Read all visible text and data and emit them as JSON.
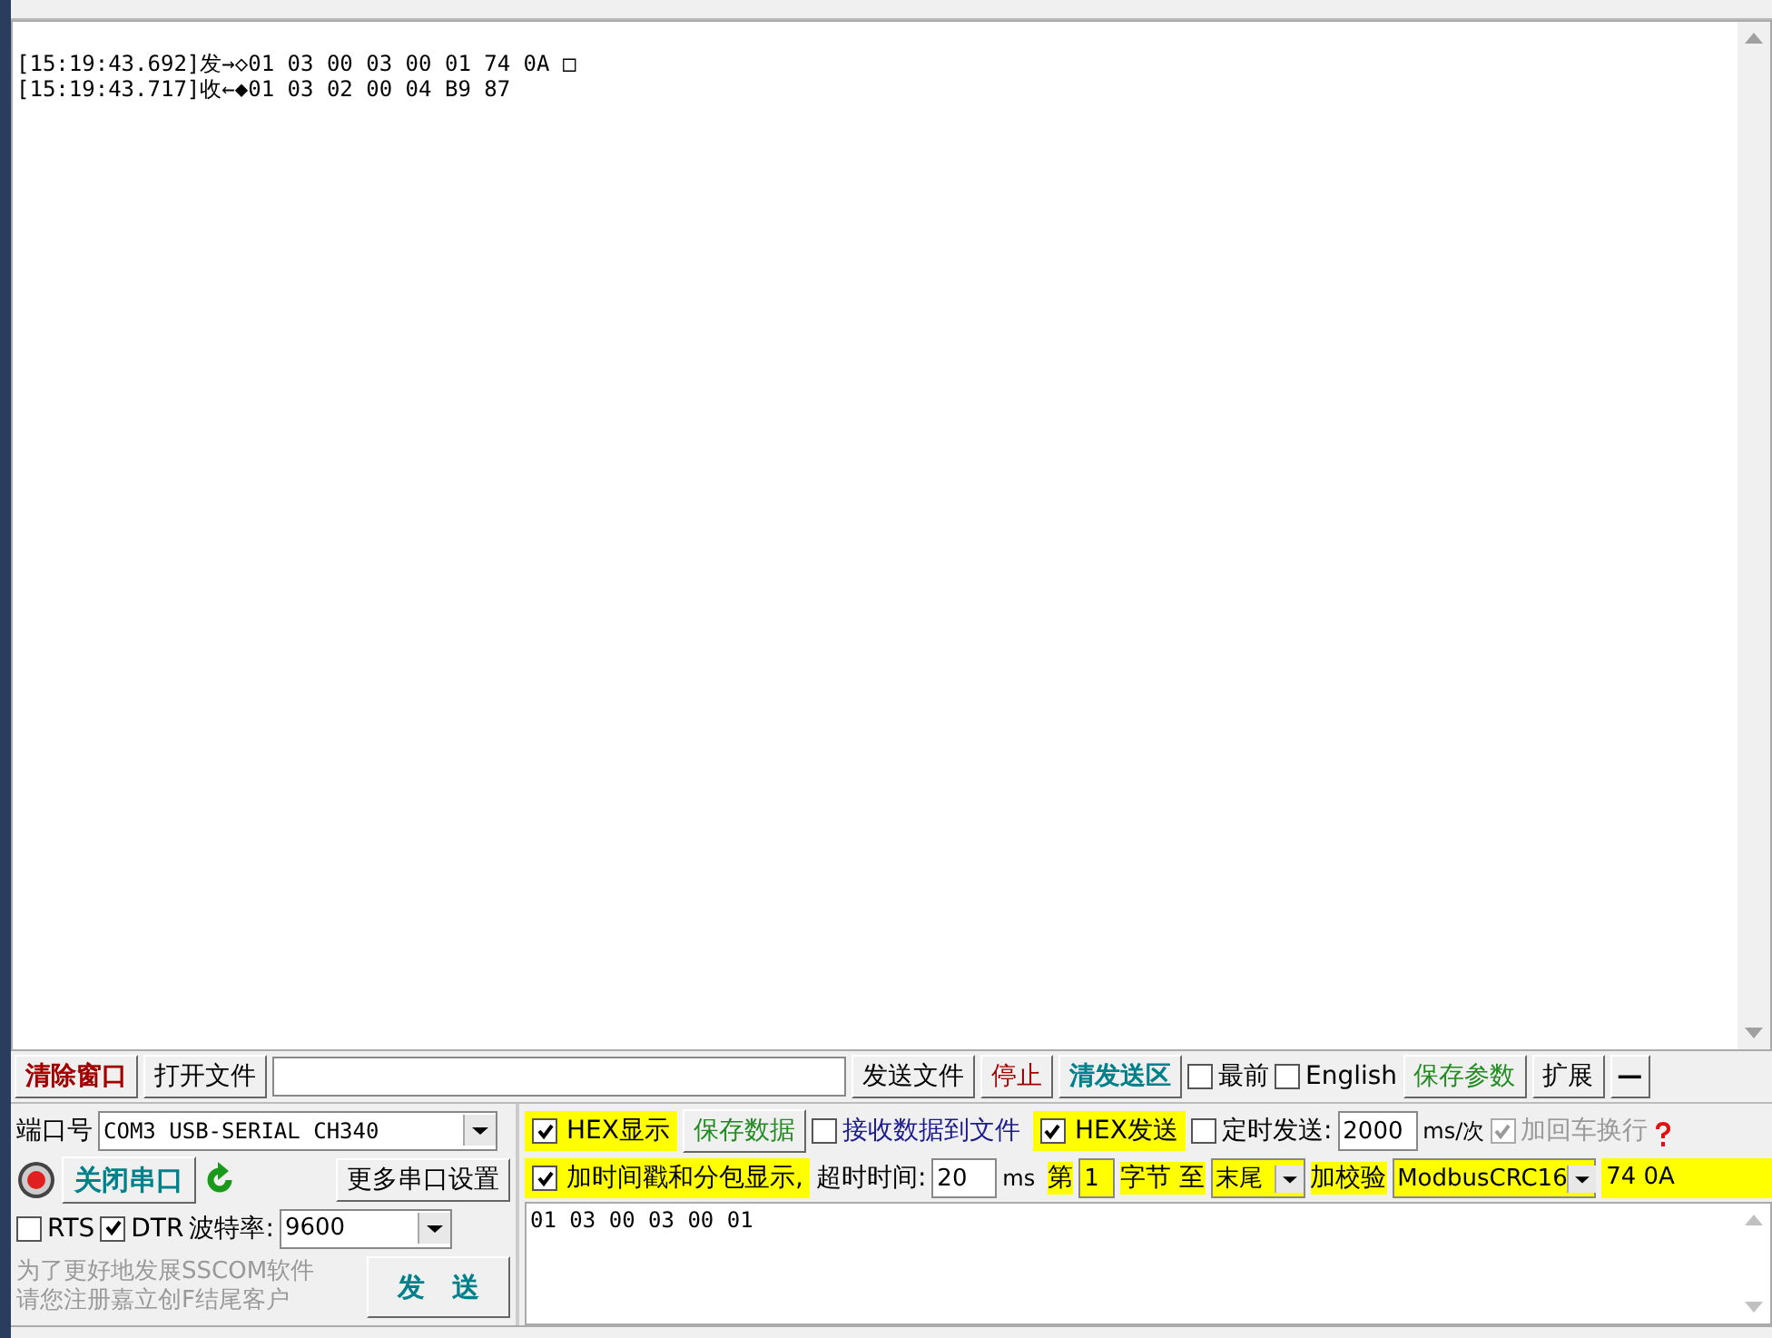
{
  "receive": {
    "lines": [
      "[15:19:43.692]发→◇01 03 00 03 00 01 74 0A □",
      "[15:19:43.717]收←◆01 03 02 00 04 B9 87"
    ]
  },
  "toolbar": {
    "clear_button": "清除窗口",
    "open_file_button": "打开文件",
    "send_file_button": "发送文件",
    "stop_button": "停止",
    "clear_send_button": "清发送区",
    "options": [
      {
        "label": "最前",
        "checked": false
      },
      {
        "label": "English",
        "checked": false
      }
    ],
    "save_params_button": "保存参数",
    "expand_button": "扩展",
    "minimize_button": "—"
  },
  "port": {
    "label": "端口号",
    "value": "COM3 USB-SERIAL CH340",
    "open": true,
    "close_button": "关闭串口",
    "more_settings_button": "更多串口设置",
    "lines": [
      {
        "label": "RTS",
        "checked": false
      },
      {
        "label": "DTR",
        "checked": true
      }
    ],
    "baud_label": "波特率:",
    "baud_value": "9600",
    "promo": [
      "为了更好地发展SSCOM软件",
      "请您注册嘉立创F结尾客户"
    ],
    "send_button": "发　送"
  },
  "display": {
    "hex_display": {
      "label": "HEX显示",
      "checked": true
    },
    "save_data_button": "保存数据",
    "receive_to_file": {
      "label": "接收数据到文件",
      "checked": false
    },
    "timestamp": {
      "label": "加时间戳和分包显示,",
      "checked": true
    },
    "timeout_label": "超时时间:",
    "timeout_value": "20",
    "timeout_unit": "ms"
  },
  "send": {
    "hex_send": {
      "label": "HEX发送",
      "checked": true
    },
    "timed_send": {
      "label": "定时发送:",
      "checked": false
    },
    "interval": "2000",
    "interval_unit": "ms/次",
    "append_newline": {
      "label": "加回车换行",
      "checked": true,
      "disabled": true
    },
    "from_label": "第",
    "from_value": "1",
    "byte_label": "字节 至",
    "to_value": "末尾",
    "checksum_label": "加校验",
    "checksum_value": "ModbusCRC16",
    "checksum_result": "74 0A",
    "text": "01 03 00 03 00 01"
  }
}
